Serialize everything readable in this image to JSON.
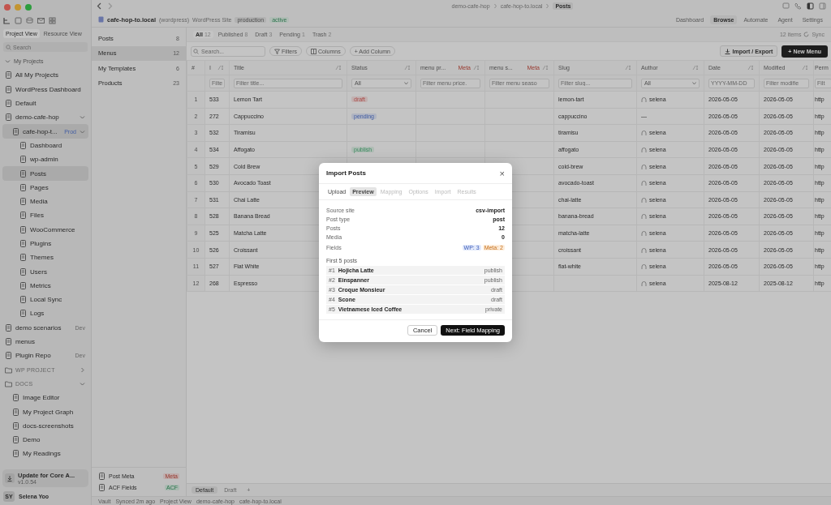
{
  "window": {
    "breadcrumb": [
      "demo-cafe-hop",
      "cafe-hop-to.local",
      "Posts"
    ]
  },
  "sidebar": {
    "view_tabs": [
      {
        "label": "Project View",
        "selected": true
      },
      {
        "label": "Resource View",
        "selected": false
      }
    ],
    "search": {
      "placeholder": "Search"
    },
    "tree": [
      {
        "kind": "group",
        "label": "My Projects",
        "expanded": true,
        "selected": false,
        "children": [
          {
            "kind": "item",
            "label": "All My Projects",
            "selected": false
          },
          {
            "kind": "item",
            "label": "WordPress Dashboard",
            "selected": false
          },
          {
            "kind": "item",
            "label": "Default",
            "selected": false
          },
          {
            "kind": "item",
            "label": "demo-cafe-hop",
            "selected": false,
            "expanded": true,
            "children": [
              {
                "kind": "item",
                "label": "cafe-hop-t...",
                "badge": "Prod",
                "selected": true,
                "expanded": true,
                "children": [
                  {
                    "kind": "item",
                    "label": "Dashboard",
                    "selected": false
                  },
                  {
                    "kind": "item",
                    "label": "wp-admin",
                    "selected": false
                  },
                  {
                    "kind": "item",
                    "label": "Posts",
                    "selected": true
                  },
                  {
                    "kind": "item",
                    "label": "Pages",
                    "selected": false
                  },
                  {
                    "kind": "item",
                    "label": "Media",
                    "selected": false
                  },
                  {
                    "kind": "item",
                    "label": "Files",
                    "selected": false
                  },
                  {
                    "kind": "item",
                    "label": "WooCommerce",
                    "selected": false
                  },
                  {
                    "kind": "item",
                    "label": "Plugins",
                    "selected": false
                  },
                  {
                    "kind": "item",
                    "label": "Themes",
                    "selected": false
                  },
                  {
                    "kind": "item",
                    "label": "Users",
                    "selected": false
                  },
                  {
                    "kind": "item",
                    "label": "Metrics",
                    "selected": false
                  },
                  {
                    "kind": "item",
                    "label": "Local Sync",
                    "selected": false
                  },
                  {
                    "kind": "item",
                    "label": "Logs",
                    "selected": false
                  }
                ]
              }
            ]
          },
          {
            "kind": "item",
            "label": "demo scenarios",
            "badge": "Dev",
            "selected": false
          },
          {
            "kind": "item",
            "label": "menus",
            "selected": false
          },
          {
            "kind": "item",
            "label": "Plugin Repo",
            "badge": "Dev",
            "selected": false
          }
        ]
      },
      {
        "kind": "section",
        "label": "WP PROJECT",
        "expanded": false,
        "selected": false
      },
      {
        "kind": "section",
        "label": "DOCS",
        "expanded": true,
        "selected": false,
        "children": [
          {
            "kind": "item",
            "label": "Image Editor",
            "selected": false
          },
          {
            "kind": "item",
            "label": "My Project Graph",
            "selected": false
          },
          {
            "kind": "item",
            "label": "docs-screenshots",
            "selected": false
          },
          {
            "kind": "item",
            "label": "Demo",
            "selected": false
          },
          {
            "kind": "item",
            "label": "My Readings",
            "selected": false
          }
        ]
      }
    ],
    "update": {
      "title": "Update for Core A...",
      "version": "v1.0.54"
    },
    "user": {
      "initials": "SY",
      "name": "Selena Yoo"
    }
  },
  "site_header": {
    "name": "cafe-hop-to.local",
    "type": "(wordpress)",
    "label": "WordPress Site",
    "env": "production",
    "status": "active"
  },
  "nav_tabs": [
    {
      "label": "Dashboard",
      "selected": false
    },
    {
      "label": "Browse",
      "selected": true
    },
    {
      "label": "Automate",
      "selected": false
    },
    {
      "label": "Agent",
      "selected": false
    },
    {
      "label": "Settings",
      "selected": false
    }
  ],
  "object_list": {
    "items": [
      {
        "label": "Posts",
        "count": "8",
        "selected": false
      },
      {
        "label": "Menus",
        "count": "12",
        "selected": true
      },
      {
        "label": "My Templates",
        "count": "6",
        "selected": false
      },
      {
        "label": "Products",
        "count": "23",
        "selected": false
      }
    ],
    "footer_items": [
      {
        "label": "Post Meta",
        "badge": "Meta",
        "kind": "meta"
      },
      {
        "label": "ACF Fields",
        "badge": "ACF",
        "kind": "acf"
      }
    ]
  },
  "status_tabs": [
    {
      "label": "All",
      "count": "12",
      "selected": true
    },
    {
      "label": "Published",
      "count": "8",
      "selected": false
    },
    {
      "label": "Draft",
      "count": "3",
      "selected": false
    },
    {
      "label": "Pending",
      "count": "1",
      "selected": false
    },
    {
      "label": "Trash",
      "count": "2",
      "selected": false
    }
  ],
  "items_count": "12 items",
  "sync": "Sync",
  "toolbar": {
    "search": {
      "placeholder": "Search..."
    },
    "filters": "Filters",
    "columns": "Columns",
    "add_column": "+ Add Column",
    "import_export": "Import / Export",
    "new": "+ New Menu"
  },
  "table": {
    "columns": [
      {
        "label": "#",
        "sortable": false
      },
      {
        "label": "I",
        "sortable": true
      },
      {
        "label": "Title",
        "sortable": true
      },
      {
        "label": "Status",
        "sortable": true
      },
      {
        "label": "menu pr...",
        "badge": "Meta",
        "sortable": true
      },
      {
        "label": "menu s...",
        "badge": "Meta",
        "sortable": true
      },
      {
        "label": "Slug",
        "sortable": true
      },
      {
        "label": "Author",
        "sortable": true
      },
      {
        "label": "Date",
        "sortable": true
      },
      {
        "label": "Modified",
        "sortable": true
      },
      {
        "label": "Perm"
      }
    ],
    "filters": [
      {
        "kind": "input",
        "placeholder": "Filte"
      },
      {
        "kind": "input",
        "placeholder": "Filter title..."
      },
      {
        "kind": "select",
        "value": "All"
      },
      {
        "kind": "input",
        "placeholder": "Filter menu price."
      },
      {
        "kind": "input",
        "placeholder": "Filter menu seaso"
      },
      {
        "kind": "input",
        "placeholder": "Filter slug..."
      },
      {
        "kind": "select",
        "value": "All"
      },
      {
        "kind": "input",
        "placeholder": "YYYY-MM-DD"
      },
      {
        "kind": "input",
        "placeholder": "Filter modifie"
      },
      {
        "kind": "input",
        "placeholder": "Filt"
      }
    ],
    "rows": [
      {
        "num": "1",
        "id": "533",
        "title": "Lemon Tart",
        "status": {
          "label": "draft",
          "kind": "draft"
        },
        "slug": "lemon-tart",
        "author": "selena",
        "avatar": true,
        "date": "2026-05-05",
        "modified": "2026-05-05",
        "permalink": "http"
      },
      {
        "num": "2",
        "id": "272",
        "title": "Cappuccino",
        "status": {
          "label": "pending",
          "kind": "pending"
        },
        "slug": "cappuccino",
        "author": "—",
        "avatar": false,
        "date": "2026-05-05",
        "modified": "2026-05-05",
        "permalink": "http"
      },
      {
        "num": "3",
        "id": "532",
        "title": "Tiramisu",
        "slug": "tiramisu",
        "author": "selena",
        "avatar": true,
        "date": "2026-05-05",
        "modified": "2026-05-05",
        "permalink": "http"
      },
      {
        "num": "4",
        "id": "534",
        "title": "Affogato",
        "status": {
          "label": "publish",
          "kind": "publish"
        },
        "slug": "affogato",
        "author": "selena",
        "avatar": true,
        "date": "2026-05-05",
        "modified": "2026-05-05",
        "permalink": "http"
      },
      {
        "num": "5",
        "id": "529",
        "title": "Cold Brew",
        "slug": "cold-brew",
        "author": "selena",
        "avatar": true,
        "date": "2026-05-05",
        "modified": "2026-05-05",
        "permalink": "http"
      },
      {
        "num": "6",
        "id": "530",
        "title": "Avocado Toast",
        "slug": "avocado-toast",
        "author": "selena",
        "avatar": true,
        "date": "2026-05-05",
        "modified": "2026-05-05",
        "permalink": "http"
      },
      {
        "num": "7",
        "id": "531",
        "title": "Chai Latte",
        "slug": "chai-latte",
        "author": "selena",
        "avatar": true,
        "date": "2026-05-05",
        "modified": "2026-05-05",
        "permalink": "http"
      },
      {
        "num": "8",
        "id": "528",
        "title": "Banana Bread",
        "slug": "banana-bread",
        "author": "selena",
        "avatar": true,
        "date": "2026-05-05",
        "modified": "2026-05-05",
        "permalink": "http"
      },
      {
        "num": "9",
        "id": "525",
        "title": "Matcha Latte",
        "slug": "matcha-latte",
        "author": "selena",
        "avatar": true,
        "date": "2026-05-05",
        "modified": "2026-05-05",
        "permalink": "http"
      },
      {
        "num": "10",
        "id": "526",
        "title": "Croissant",
        "slug": "croissant",
        "author": "selena",
        "avatar": true,
        "date": "2026-05-05",
        "modified": "2026-05-05",
        "permalink": "http"
      },
      {
        "num": "11",
        "id": "527",
        "title": "Flat White",
        "slug": "flat-white",
        "author": "selena",
        "avatar": true,
        "date": "2026-05-05",
        "modified": "2026-05-05",
        "permalink": "http"
      },
      {
        "num": "12",
        "id": "268",
        "title": "Espresso",
        "author": "selena",
        "avatar": true,
        "date": "2025-08-12",
        "modified": "2025-08-12",
        "permalink": "http"
      }
    ]
  },
  "bottom_tabs": [
    {
      "label": "Default",
      "selected": true
    },
    {
      "label": "Draft",
      "selected": false
    }
  ],
  "add_tab": "+",
  "status_bar": [
    "Vault",
    "Synced 2m ago",
    "Project View",
    "demo-cafe-hop",
    "cafe-hop-to.local"
  ],
  "dialog": {
    "title": "Import Posts",
    "close": "×",
    "steps": [
      {
        "label": "Upload",
        "selected": false,
        "disabled": false
      },
      {
        "label": "Preview",
        "selected": true,
        "disabled": false
      },
      {
        "label": "Mapping",
        "selected": false,
        "disabled": true
      },
      {
        "label": "Options",
        "selected": false,
        "disabled": true
      },
      {
        "label": "Import",
        "selected": false,
        "disabled": true
      },
      {
        "label": "Results",
        "selected": false,
        "disabled": true
      }
    ],
    "summary": [
      {
        "label": "Source site",
        "value": "csv-import"
      },
      {
        "label": "Post type",
        "value": "post"
      },
      {
        "label": "Posts",
        "value": "12"
      },
      {
        "label": "Media",
        "value": "0"
      }
    ],
    "fields": {
      "label": "Fields",
      "tags": [
        {
          "text": "WP: 3",
          "kind": "wp"
        },
        {
          "text": "Meta: 2",
          "kind": "meta"
        }
      ]
    },
    "posts_heading": "First 5 posts",
    "posts": [
      {
        "num": "#1",
        "title": "Hojicha Latte",
        "status": "publish"
      },
      {
        "num": "#2",
        "title": "Einspanner",
        "status": "publish"
      },
      {
        "num": "#3",
        "title": "Croque Monsieur",
        "status": "draft"
      },
      {
        "num": "#4",
        "title": "Scone",
        "status": "draft"
      },
      {
        "num": "#5",
        "title": "Vietnamese Iced Coffee",
        "status": "private"
      }
    ],
    "cancel": "Cancel",
    "next": "Next: Field Mapping"
  }
}
